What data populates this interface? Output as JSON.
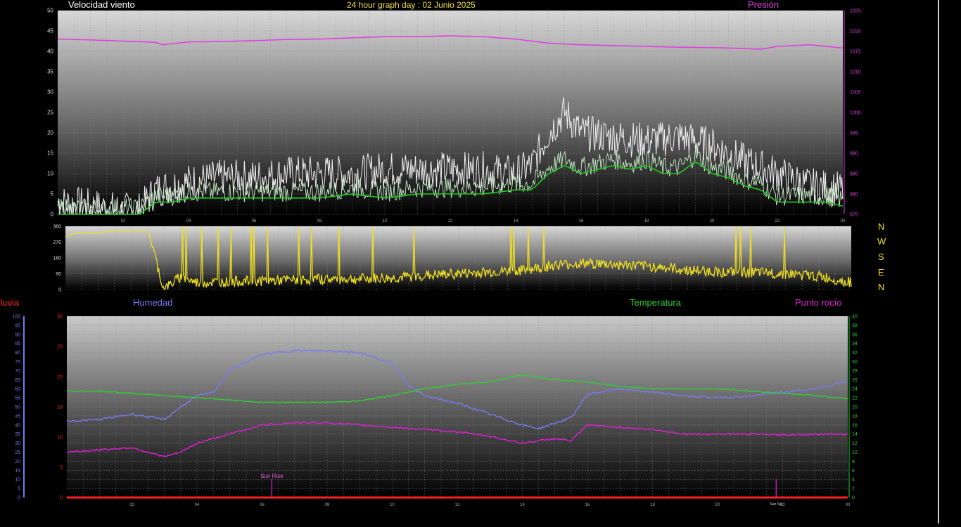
{
  "header": {
    "title": "24 hour graph day : 02 Junio 2025",
    "wind_label": "Velocidad viento",
    "pressure_label": "Presión"
  },
  "colors": {
    "white_series": "#f0f0f0",
    "green_series": "#22cc22",
    "pressure": "#e040e0",
    "direction": "#f0e020",
    "humidity": "#7a7af0",
    "temperature": "#30d030",
    "dewpoint": "#e020d0",
    "rain": "#ff2020",
    "title": "#f0e040"
  },
  "compass_labels": [
    "N",
    "W",
    "S",
    "E",
    "N"
  ],
  "bottom_labels": {
    "rain": "Lluvia",
    "humidity": "Humedad",
    "temperature": "Temperatura",
    "dewpoint": "Punto rocío"
  },
  "annotations": {
    "sunrise": "Sun Rise",
    "sunset": "Sun Set"
  },
  "chart_data": [
    {
      "type": "line",
      "title": "Velocidad viento",
      "x_ticks": [
        "02",
        "04",
        "06",
        "08",
        "10",
        "12",
        "14",
        "16",
        "18",
        "20",
        "22",
        "00"
      ],
      "ylim_left": [
        0,
        50
      ],
      "y_ticks_left": [
        0,
        5,
        10,
        15,
        20,
        25,
        30,
        35,
        40,
        45,
        50
      ],
      "ylim_right": [
        975,
        1025
      ],
      "y_ticks_right": [
        975,
        980,
        985,
        990,
        995,
        1000,
        1005,
        1010,
        1015,
        1020,
        1025
      ],
      "grid": true,
      "series": [
        {
          "name": "Presión",
          "axis": "right",
          "x": [
            0,
            1,
            2,
            3,
            3.2,
            4,
            5,
            6,
            7,
            8,
            9,
            10,
            11,
            12,
            13,
            14,
            15,
            16,
            17,
            18,
            19,
            20,
            21,
            21.5,
            22,
            23,
            24
          ],
          "values": [
            1018,
            1017.8,
            1017.5,
            1017.2,
            1016.6,
            1017.3,
            1017.4,
            1017.6,
            1017.9,
            1018,
            1018.3,
            1018.6,
            1018.6,
            1018.8,
            1018.6,
            1018,
            1017,
            1016.6,
            1016.4,
            1016.2,
            1016,
            1015.9,
            1015.7,
            1015.5,
            1016.2,
            1016.6,
            1015.8
          ]
        },
        {
          "name": "",
          "axis": "left",
          "note_series": "gust",
          "x": [
            0,
            1,
            2,
            2.5,
            3,
            4,
            5,
            6,
            7,
            8,
            9,
            10,
            11,
            12,
            13,
            14,
            14.5,
            15,
            15.5,
            16,
            17,
            18,
            19,
            20,
            21,
            22,
            23,
            24
          ],
          "values": [
            3,
            2,
            1,
            1,
            6,
            8,
            9,
            9,
            10,
            10,
            10,
            11,
            11,
            11,
            11,
            10,
            12,
            20,
            25,
            20,
            19,
            18,
            19,
            17,
            13,
            10,
            7,
            6
          ]
        },
        {
          "name": "",
          "axis": "left",
          "note_series": "average",
          "x": [
            0,
            0.5,
            1,
            2,
            2.5,
            3,
            3.5,
            4,
            5,
            6,
            7,
            8,
            9,
            10,
            11,
            12,
            13,
            14,
            14.5,
            15,
            15.5,
            16,
            16.5,
            17,
            17.5,
            18,
            18.5,
            19,
            19.5,
            20,
            20.5,
            21,
            21.5,
            22,
            22.5,
            23,
            23.5,
            24
          ],
          "values": [
            0,
            0,
            0,
            0,
            0,
            3,
            3,
            4,
            4,
            4,
            4,
            4,
            5,
            4,
            5,
            5,
            5,
            6,
            6,
            10,
            12,
            10,
            11,
            12,
            11,
            12,
            10,
            10,
            13,
            10,
            9,
            7,
            6,
            3,
            3,
            3,
            3,
            2
          ]
        }
      ]
    },
    {
      "type": "line",
      "title": "",
      "x_ticks": [
        "02",
        "04",
        "06",
        "08",
        "10",
        "12",
        "14",
        "16",
        "18",
        "20",
        "22",
        "00"
      ],
      "ylim": [
        0,
        360
      ],
      "y_ticks": [
        0,
        90,
        180,
        270,
        360
      ],
      "grid": true,
      "series": [
        {
          "name": "",
          "note_series": "wind direction",
          "x": [
            0,
            0.3,
            1,
            1.5,
            2,
            2.5,
            2.6,
            3,
            3.5,
            4,
            5,
            6,
            7,
            8,
            9,
            10,
            11,
            12,
            13,
            14,
            15,
            16,
            17,
            18,
            19,
            20,
            21,
            22,
            23,
            24
          ],
          "values": [
            300,
            320,
            320,
            335,
            335,
            335,
            290,
            0,
            70,
            40,
            45,
            50,
            55,
            60,
            60,
            65,
            80,
            90,
            100,
            110,
            140,
            150,
            140,
            130,
            110,
            100,
            95,
            90,
            75,
            40
          ]
        }
      ]
    },
    {
      "type": "line",
      "title": "",
      "x_ticks": [
        "02",
        "04",
        "06",
        "08",
        "10",
        "12",
        "14",
        "16",
        "18",
        "20",
        "22",
        "00"
      ],
      "ylim_left_rain": [
        0,
        30
      ],
      "y_ticks_left_rain": [
        0,
        5,
        10,
        15,
        20,
        25,
        30
      ],
      "ylim_humidity": [
        0,
        100
      ],
      "y_ticks_humidity": [
        0,
        5,
        10,
        15,
        20,
        25,
        30,
        35,
        40,
        45,
        50,
        55,
        60,
        65,
        70,
        75,
        80,
        85,
        90,
        95,
        100
      ],
      "ylim_right": [
        0,
        40
      ],
      "y_ticks_right": [
        0,
        2,
        4,
        6,
        8,
        10,
        12,
        14,
        16,
        18,
        20,
        22,
        24,
        26,
        28,
        30,
        32,
        34,
        36,
        38,
        40
      ],
      "grid": true,
      "series": [
        {
          "name": "Humedad",
          "axis": "humidity",
          "x": [
            0,
            1,
            2,
            3,
            3.5,
            4,
            4.5,
            5,
            6,
            7,
            8,
            9,
            10,
            10.5,
            11,
            12,
            13,
            14,
            14.5,
            15,
            15.5,
            16,
            17,
            18,
            19,
            20,
            21,
            22,
            23,
            24
          ],
          "values": [
            42,
            43,
            46,
            43,
            50,
            56,
            58,
            70,
            79,
            81,
            81,
            80,
            74,
            62,
            56,
            52,
            46,
            40,
            38,
            41,
            44,
            57,
            60,
            58,
            56,
            55,
            56,
            58,
            60,
            64
          ]
        },
        {
          "name": "Temperatura",
          "axis": "right",
          "x": [
            0,
            1,
            2,
            3,
            4,
            5,
            6,
            7,
            8,
            9,
            10,
            11,
            12,
            13,
            14,
            15,
            16,
            17,
            18,
            19,
            20,
            21,
            22,
            23,
            24
          ],
          "values": [
            23.5,
            23.5,
            23,
            22.5,
            22,
            21.5,
            21,
            21,
            21,
            21.3,
            22.5,
            24,
            25,
            25.5,
            27,
            26,
            25.5,
            24.5,
            24,
            24,
            24,
            23.5,
            23,
            22.5,
            21.8
          ]
        },
        {
          "name": "Punto rocío",
          "axis": "right",
          "x": [
            0,
            1,
            2,
            3,
            3.5,
            4,
            5,
            6,
            7,
            8,
            9,
            10,
            11,
            12,
            13,
            14,
            15,
            15.5,
            16,
            17,
            18,
            19,
            20,
            21,
            22,
            23,
            24
          ],
          "values": [
            10,
            10.5,
            11,
            9,
            10,
            12,
            14,
            16,
            16.5,
            16.5,
            16,
            15.5,
            15,
            14.5,
            13.5,
            12,
            13,
            12.5,
            16,
            15.5,
            15,
            14,
            14,
            14,
            13.8,
            14,
            14
          ]
        },
        {
          "name": "Lluvia",
          "axis": "rain",
          "x": [
            0,
            24
          ],
          "values": [
            0,
            0
          ]
        }
      ],
      "events": [
        {
          "label": "Sun Rise",
          "x": 6.3
        },
        {
          "label": "Sun Set",
          "x": 21.8
        }
      ]
    }
  ]
}
